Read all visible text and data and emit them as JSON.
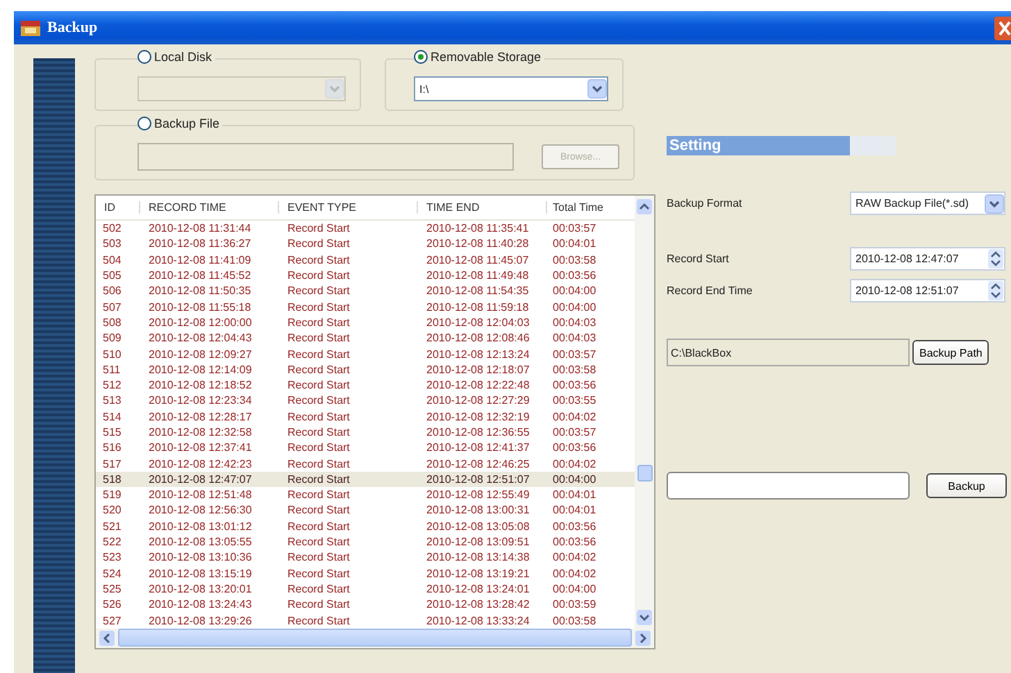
{
  "window": {
    "title": "Backup"
  },
  "sources": [
    {
      "kind": "combo",
      "label": "Local Disk",
      "selected": false,
      "disabled": true
    },
    {
      "kind": "combo",
      "label": "Removable Storage",
      "selected": true,
      "disabled": false,
      "value": "I:\\"
    },
    {
      "kind": "file",
      "label": "Backup File",
      "selected": false,
      "disabled": true,
      "button": "Browse..."
    }
  ],
  "table": {
    "columns": [
      "ID",
      "RECORD TIME",
      "EVENT TYPE",
      "TIME END",
      "Total Time"
    ],
    "rows": [
      {
        "cells": [
          "502",
          "2010-12-08 11:31:44",
          "Record Start",
          "2010-12-08 11:35:41",
          "00:03:57"
        ],
        "selected": false
      },
      {
        "cells": [
          "503",
          "2010-12-08 11:36:27",
          "Record Start",
          "2010-12-08 11:40:28",
          "00:04:01"
        ],
        "selected": false
      },
      {
        "cells": [
          "504",
          "2010-12-08 11:41:09",
          "Record Start",
          "2010-12-08 11:45:07",
          "00:03:58"
        ],
        "selected": false
      },
      {
        "cells": [
          "505",
          "2010-12-08 11:45:52",
          "Record Start",
          "2010-12-08 11:49:48",
          "00:03:56"
        ],
        "selected": false
      },
      {
        "cells": [
          "506",
          "2010-12-08 11:50:35",
          "Record Start",
          "2010-12-08 11:54:35",
          "00:04:00"
        ],
        "selected": false
      },
      {
        "cells": [
          "507",
          "2010-12-08 11:55:18",
          "Record Start",
          "2010-12-08 11:59:18",
          "00:04:00"
        ],
        "selected": false
      },
      {
        "cells": [
          "508",
          "2010-12-08 12:00:00",
          "Record Start",
          "2010-12-08 12:04:03",
          "00:04:03"
        ],
        "selected": false
      },
      {
        "cells": [
          "509",
          "2010-12-08 12:04:43",
          "Record Start",
          "2010-12-08 12:08:46",
          "00:04:03"
        ],
        "selected": false
      },
      {
        "cells": [
          "510",
          "2010-12-08 12:09:27",
          "Record Start",
          "2010-12-08 12:13:24",
          "00:03:57"
        ],
        "selected": false
      },
      {
        "cells": [
          "511",
          "2010-12-08 12:14:09",
          "Record Start",
          "2010-12-08 12:18:07",
          "00:03:58"
        ],
        "selected": false
      },
      {
        "cells": [
          "512",
          "2010-12-08 12:18:52",
          "Record Start",
          "2010-12-08 12:22:48",
          "00:03:56"
        ],
        "selected": false
      },
      {
        "cells": [
          "513",
          "2010-12-08 12:23:34",
          "Record Start",
          "2010-12-08 12:27:29",
          "00:03:55"
        ],
        "selected": false
      },
      {
        "cells": [
          "514",
          "2010-12-08 12:28:17",
          "Record Start",
          "2010-12-08 12:32:19",
          "00:04:02"
        ],
        "selected": false
      },
      {
        "cells": [
          "515",
          "2010-12-08 12:32:58",
          "Record Start",
          "2010-12-08 12:36:55",
          "00:03:57"
        ],
        "selected": false
      },
      {
        "cells": [
          "516",
          "2010-12-08 12:37:41",
          "Record Start",
          "2010-12-08 12:41:37",
          "00:03:56"
        ],
        "selected": false
      },
      {
        "cells": [
          "517",
          "2010-12-08 12:42:23",
          "Record Start",
          "2010-12-08 12:46:25",
          "00:04:02"
        ],
        "selected": false
      },
      {
        "cells": [
          "518",
          "2010-12-08 12:47:07",
          "Record Start",
          "2010-12-08 12:51:07",
          "00:04:00"
        ],
        "selected": true
      },
      {
        "cells": [
          "519",
          "2010-12-08 12:51:48",
          "Record Start",
          "2010-12-08 12:55:49",
          "00:04:01"
        ],
        "selected": false
      },
      {
        "cells": [
          "520",
          "2010-12-08 12:56:30",
          "Record Start",
          "2010-12-08 13:00:31",
          "00:04:01"
        ],
        "selected": false
      },
      {
        "cells": [
          "521",
          "2010-12-08 13:01:12",
          "Record Start",
          "2010-12-08 13:05:08",
          "00:03:56"
        ],
        "selected": false
      },
      {
        "cells": [
          "522",
          "2010-12-08 13:05:55",
          "Record Start",
          "2010-12-08 13:09:51",
          "00:03:56"
        ],
        "selected": false
      },
      {
        "cells": [
          "523",
          "2010-12-08 13:10:36",
          "Record Start",
          "2010-12-08 13:14:38",
          "00:04:02"
        ],
        "selected": false
      },
      {
        "cells": [
          "524",
          "2010-12-08 13:15:19",
          "Record Start",
          "2010-12-08 13:19:21",
          "00:04:02"
        ],
        "selected": false
      },
      {
        "cells": [
          "525",
          "2010-12-08 13:20:01",
          "Record Start",
          "2010-12-08 13:24:01",
          "00:04:00"
        ],
        "selected": false
      },
      {
        "cells": [
          "526",
          "2010-12-08 13:24:43",
          "Record Start",
          "2010-12-08 13:28:42",
          "00:03:59"
        ],
        "selected": false
      },
      {
        "cells": [
          "527",
          "2010-12-08 13:29:26",
          "Record Start",
          "2010-12-08 13:33:24",
          "00:03:58"
        ],
        "selected": false
      }
    ]
  },
  "settings": {
    "title": "Setting",
    "fields": [
      {
        "kind": "select",
        "label": "Backup Format",
        "value": "RAW Backup File(*.sd)"
      },
      {
        "kind": "spinner",
        "label": "Record Start",
        "value": "2010-12-08 12:47:07"
      },
      {
        "kind": "spinner",
        "label": "Record End Time",
        "value": "2010-12-08 12:51:07"
      }
    ],
    "path": {
      "value": "C:\\BlackBox",
      "button": "Backup Path"
    },
    "backup": {
      "button": "Backup"
    }
  }
}
